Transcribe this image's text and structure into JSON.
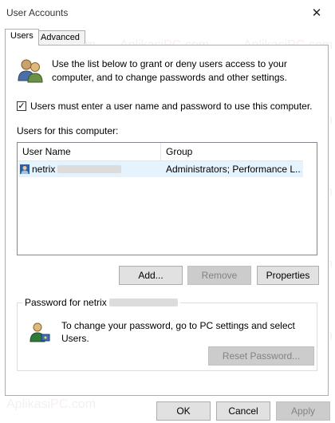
{
  "window": {
    "title": "User Accounts",
    "close_glyph": "✕"
  },
  "tabs": [
    {
      "label": "Users",
      "active": true
    },
    {
      "label": "Advanced",
      "active": false
    }
  ],
  "intro": {
    "text": "Use the list below to grant or deny users access to your computer, and to change passwords and other settings.",
    "icon": "users-icon"
  },
  "require_login": {
    "label": "Users must enter a user name and password to use this computer.",
    "checked": true
  },
  "users_section": {
    "label": "Users for this computer:"
  },
  "table": {
    "columns": [
      "User Name",
      "Group"
    ],
    "rows": [
      {
        "user_name": "netrix",
        "group": "Administrators; Performance L..."
      }
    ]
  },
  "buttons": {
    "add": "Add...",
    "remove": "Remove",
    "properties": "Properties"
  },
  "password_group": {
    "title": "Password for netrix",
    "text": "To change your password, go to PC settings and select Users.",
    "reset_button": "Reset Password...",
    "icon": "user-key-icon"
  },
  "dialog_buttons": {
    "ok": "OK",
    "cancel": "Cancel",
    "apply": "Apply"
  },
  "watermark": {
    "brand": "AplikasiPC",
    "suffix": ".com"
  },
  "colors": {
    "selection": "#e5f3ff",
    "disabled_text": "#838383"
  }
}
